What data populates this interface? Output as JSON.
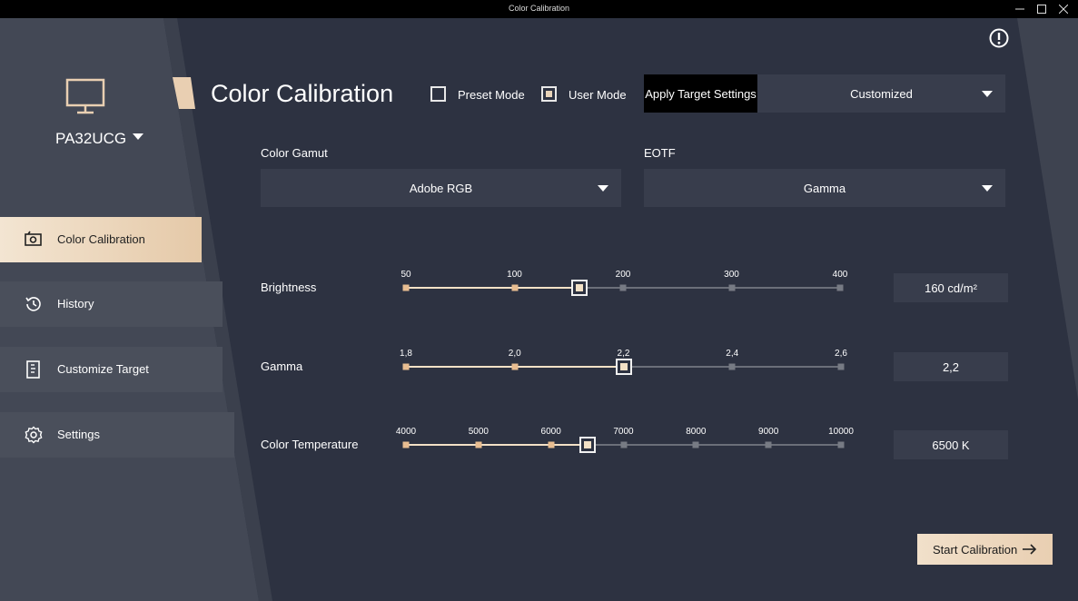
{
  "window": {
    "title": "Color Calibration"
  },
  "sidebar": {
    "model": "PA32UCG",
    "items": [
      {
        "label": "Color Calibration",
        "icon": "calibration-icon",
        "active": true
      },
      {
        "label": "History",
        "icon": "history-icon",
        "active": false
      },
      {
        "label": "Customize Target",
        "icon": "target-ruler-icon",
        "active": false
      },
      {
        "label": "Settings",
        "icon": "gear-icon",
        "active": false
      }
    ]
  },
  "header": {
    "title": "Color Calibration",
    "preset_mode": {
      "label": "Preset Mode",
      "checked": false
    },
    "user_mode": {
      "label": "User Mode",
      "checked": true
    },
    "apply_button": "Apply Target Settings",
    "target_select": "Customized"
  },
  "gamut": {
    "label": "Color Gamut",
    "value": "Adobe RGB"
  },
  "eotf": {
    "label": "EOTF",
    "value": "Gamma"
  },
  "sliders": [
    {
      "label": "Brightness",
      "ticks": [
        "50",
        "100",
        "200",
        "300",
        "400"
      ],
      "value_label": "160 cd/m²",
      "position": 1.6
    },
    {
      "label": "Gamma",
      "ticks": [
        "1,8",
        "2,0",
        "2,2",
        "2,4",
        "2,6"
      ],
      "value_label": "2,2",
      "position": 2
    },
    {
      "label": "Color Temperature",
      "ticks": [
        "4000",
        "5000",
        "6000",
        "7000",
        "8000",
        "9000",
        "10000"
      ],
      "value_label": "6500 K",
      "position": 2.5
    }
  ],
  "start_button": "Start Calibration",
  "colors": {
    "accent": "#e9cfb2",
    "background": "#2d3241",
    "sidebar": "#464b57"
  }
}
